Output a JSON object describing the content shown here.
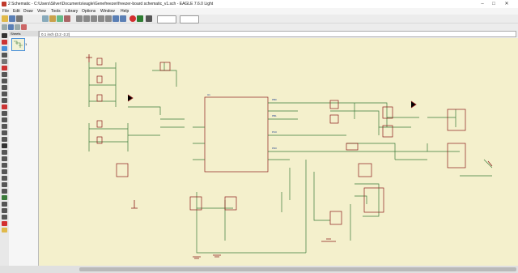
{
  "window": {
    "title": "2 Schematic - C:\\Users\\Silver\\Documents\\eagle\\Genefreezer\\freezer-board schematic_v1.sch - EAGLE 7.6.0 Light",
    "minimize": "–",
    "maximize": "□",
    "close": "✕"
  },
  "menu": [
    "File",
    "Edit",
    "Draw",
    "View",
    "Tools",
    "Library",
    "Options",
    "Window",
    "Help"
  ],
  "toolbar": {
    "sheet_selector": "1/2",
    "sheets_header": "Sheets",
    "sheet_thumb_number": "1"
  },
  "command": {
    "coordinates": "0.1 inch (3.2 -2.2)"
  },
  "colors": {
    "canvas": "#f4f0cc",
    "wire": "#3a7a3a",
    "part": "#8b1a1a",
    "net": "#1a3b8b"
  }
}
